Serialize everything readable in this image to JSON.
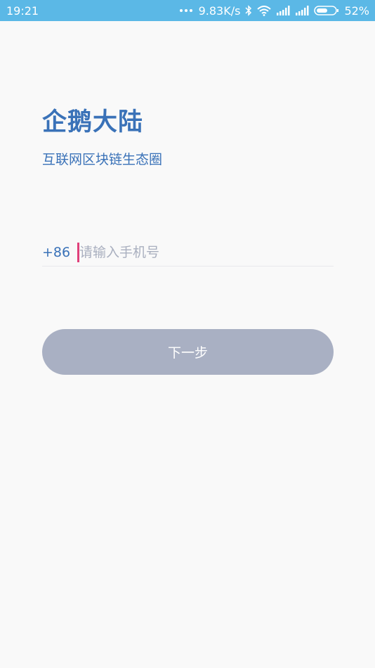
{
  "status_bar": {
    "time": "19:21",
    "network_speed": "9.83K/s",
    "battery": "52%",
    "icons": [
      "more-dots-icon",
      "bluetooth-icon",
      "wifi-icon",
      "signal-icon",
      "signal-icon",
      "battery-icon"
    ]
  },
  "app": {
    "title": "企鹅大陆",
    "subtitle": "互联网区块链生态圈"
  },
  "login": {
    "country_code": "+86",
    "phone_value": "",
    "phone_placeholder": "请输入手机号",
    "next_label": "下一步"
  },
  "colors": {
    "status_bar": "#5bb8e6",
    "brand_blue": "#3a72b8",
    "button_disabled": "#a9b0c3",
    "caret": "#e0407a",
    "background": "#f9f9f9"
  }
}
